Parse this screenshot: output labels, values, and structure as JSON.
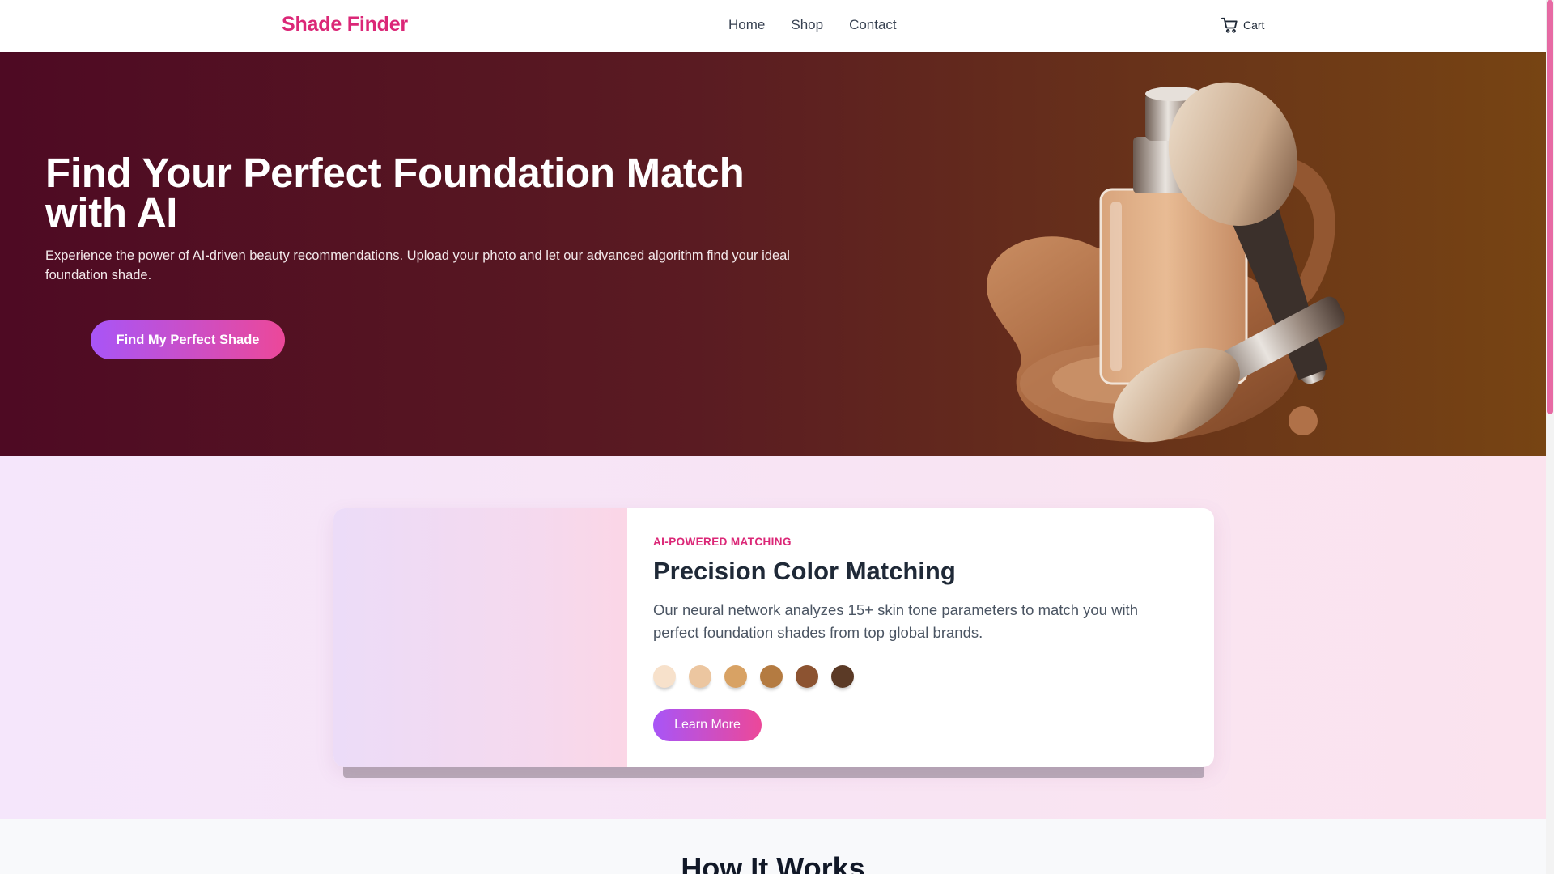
{
  "header": {
    "logo": "Shade Finder",
    "nav": [
      "Home",
      "Shop",
      "Contact"
    ],
    "cart_label": "Cart",
    "cart_icon": "cart-icon"
  },
  "hero": {
    "title": "Find Your Perfect Foundation Match with AI",
    "subtitle": "Experience the power of AI-driven beauty recommendations. Upload your photo and let our advanced algorithm find your ideal foundation shade.",
    "cta_label": "Find My Perfect Shade"
  },
  "feature": {
    "eyebrow": "AI-POWERED MATCHING",
    "title": "Precision Color Matching",
    "description": "Our neural network analyzes 15+ skin tone parameters to match you with perfect foundation shades from top global brands.",
    "swatch_colors": [
      "#f7e1cb",
      "#ecc6a0",
      "#d8a264",
      "#b47b41",
      "#8c5331",
      "#5b3a26"
    ],
    "button_label": "Learn More"
  },
  "how_it_works": {
    "title": "How It Works"
  },
  "colors": {
    "brand": "#db2777",
    "gradient_start": "#a855f7",
    "gradient_end": "#ec4899"
  }
}
